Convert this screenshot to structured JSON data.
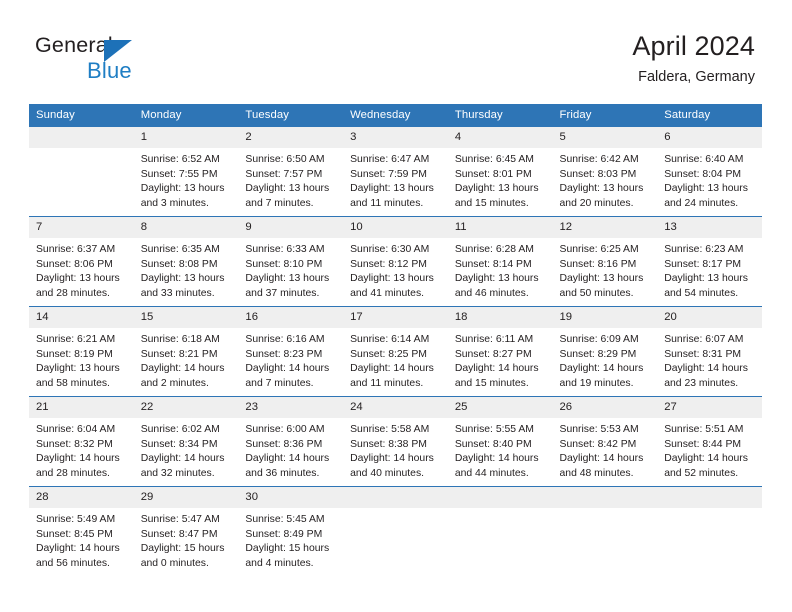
{
  "brand": {
    "name_part1": "General",
    "name_part2": "Blue",
    "accent_color": "#1f7ec4",
    "triangle_color": "#1d71b8"
  },
  "header": {
    "title": "April 2024",
    "subtitle": "Faldera, Germany",
    "header_bg": "#2e75b6",
    "header_text_color": "#ffffff",
    "daynum_bg": "#efefef"
  },
  "weekdays": [
    "Sunday",
    "Monday",
    "Tuesday",
    "Wednesday",
    "Thursday",
    "Friday",
    "Saturday"
  ],
  "labels": {
    "sunrise_prefix": "Sunrise:",
    "sunset_prefix": "Sunset:",
    "daylight_prefix": "Daylight:"
  },
  "weeks": [
    [
      {
        "day": "",
        "empty": true
      },
      {
        "day": "1",
        "sunrise": "Sunrise: 6:52 AM",
        "sunset": "Sunset: 7:55 PM",
        "daylight1": "Daylight: 13 hours",
        "daylight2": "and 3 minutes."
      },
      {
        "day": "2",
        "sunrise": "Sunrise: 6:50 AM",
        "sunset": "Sunset: 7:57 PM",
        "daylight1": "Daylight: 13 hours",
        "daylight2": "and 7 minutes."
      },
      {
        "day": "3",
        "sunrise": "Sunrise: 6:47 AM",
        "sunset": "Sunset: 7:59 PM",
        "daylight1": "Daylight: 13 hours",
        "daylight2": "and 11 minutes."
      },
      {
        "day": "4",
        "sunrise": "Sunrise: 6:45 AM",
        "sunset": "Sunset: 8:01 PM",
        "daylight1": "Daylight: 13 hours",
        "daylight2": "and 15 minutes."
      },
      {
        "day": "5",
        "sunrise": "Sunrise: 6:42 AM",
        "sunset": "Sunset: 8:03 PM",
        "daylight1": "Daylight: 13 hours",
        "daylight2": "and 20 minutes."
      },
      {
        "day": "6",
        "sunrise": "Sunrise: 6:40 AM",
        "sunset": "Sunset: 8:04 PM",
        "daylight1": "Daylight: 13 hours",
        "daylight2": "and 24 minutes."
      }
    ],
    [
      {
        "day": "7",
        "sunrise": "Sunrise: 6:37 AM",
        "sunset": "Sunset: 8:06 PM",
        "daylight1": "Daylight: 13 hours",
        "daylight2": "and 28 minutes."
      },
      {
        "day": "8",
        "sunrise": "Sunrise: 6:35 AM",
        "sunset": "Sunset: 8:08 PM",
        "daylight1": "Daylight: 13 hours",
        "daylight2": "and 33 minutes."
      },
      {
        "day": "9",
        "sunrise": "Sunrise: 6:33 AM",
        "sunset": "Sunset: 8:10 PM",
        "daylight1": "Daylight: 13 hours",
        "daylight2": "and 37 minutes."
      },
      {
        "day": "10",
        "sunrise": "Sunrise: 6:30 AM",
        "sunset": "Sunset: 8:12 PM",
        "daylight1": "Daylight: 13 hours",
        "daylight2": "and 41 minutes."
      },
      {
        "day": "11",
        "sunrise": "Sunrise: 6:28 AM",
        "sunset": "Sunset: 8:14 PM",
        "daylight1": "Daylight: 13 hours",
        "daylight2": "and 46 minutes."
      },
      {
        "day": "12",
        "sunrise": "Sunrise: 6:25 AM",
        "sunset": "Sunset: 8:16 PM",
        "daylight1": "Daylight: 13 hours",
        "daylight2": "and 50 minutes."
      },
      {
        "day": "13",
        "sunrise": "Sunrise: 6:23 AM",
        "sunset": "Sunset: 8:17 PM",
        "daylight1": "Daylight: 13 hours",
        "daylight2": "and 54 minutes."
      }
    ],
    [
      {
        "day": "14",
        "sunrise": "Sunrise: 6:21 AM",
        "sunset": "Sunset: 8:19 PM",
        "daylight1": "Daylight: 13 hours",
        "daylight2": "and 58 minutes."
      },
      {
        "day": "15",
        "sunrise": "Sunrise: 6:18 AM",
        "sunset": "Sunset: 8:21 PM",
        "daylight1": "Daylight: 14 hours",
        "daylight2": "and 2 minutes."
      },
      {
        "day": "16",
        "sunrise": "Sunrise: 6:16 AM",
        "sunset": "Sunset: 8:23 PM",
        "daylight1": "Daylight: 14 hours",
        "daylight2": "and 7 minutes."
      },
      {
        "day": "17",
        "sunrise": "Sunrise: 6:14 AM",
        "sunset": "Sunset: 8:25 PM",
        "daylight1": "Daylight: 14 hours",
        "daylight2": "and 11 minutes."
      },
      {
        "day": "18",
        "sunrise": "Sunrise: 6:11 AM",
        "sunset": "Sunset: 8:27 PM",
        "daylight1": "Daylight: 14 hours",
        "daylight2": "and 15 minutes."
      },
      {
        "day": "19",
        "sunrise": "Sunrise: 6:09 AM",
        "sunset": "Sunset: 8:29 PM",
        "daylight1": "Daylight: 14 hours",
        "daylight2": "and 19 minutes."
      },
      {
        "day": "20",
        "sunrise": "Sunrise: 6:07 AM",
        "sunset": "Sunset: 8:31 PM",
        "daylight1": "Daylight: 14 hours",
        "daylight2": "and 23 minutes."
      }
    ],
    [
      {
        "day": "21",
        "sunrise": "Sunrise: 6:04 AM",
        "sunset": "Sunset: 8:32 PM",
        "daylight1": "Daylight: 14 hours",
        "daylight2": "and 28 minutes."
      },
      {
        "day": "22",
        "sunrise": "Sunrise: 6:02 AM",
        "sunset": "Sunset: 8:34 PM",
        "daylight1": "Daylight: 14 hours",
        "daylight2": "and 32 minutes."
      },
      {
        "day": "23",
        "sunrise": "Sunrise: 6:00 AM",
        "sunset": "Sunset: 8:36 PM",
        "daylight1": "Daylight: 14 hours",
        "daylight2": "and 36 minutes."
      },
      {
        "day": "24",
        "sunrise": "Sunrise: 5:58 AM",
        "sunset": "Sunset: 8:38 PM",
        "daylight1": "Daylight: 14 hours",
        "daylight2": "and 40 minutes."
      },
      {
        "day": "25",
        "sunrise": "Sunrise: 5:55 AM",
        "sunset": "Sunset: 8:40 PM",
        "daylight1": "Daylight: 14 hours",
        "daylight2": "and 44 minutes."
      },
      {
        "day": "26",
        "sunrise": "Sunrise: 5:53 AM",
        "sunset": "Sunset: 8:42 PM",
        "daylight1": "Daylight: 14 hours",
        "daylight2": "and 48 minutes."
      },
      {
        "day": "27",
        "sunrise": "Sunrise: 5:51 AM",
        "sunset": "Sunset: 8:44 PM",
        "daylight1": "Daylight: 14 hours",
        "daylight2": "and 52 minutes."
      }
    ],
    [
      {
        "day": "28",
        "sunrise": "Sunrise: 5:49 AM",
        "sunset": "Sunset: 8:45 PM",
        "daylight1": "Daylight: 14 hours",
        "daylight2": "and 56 minutes."
      },
      {
        "day": "29",
        "sunrise": "Sunrise: 5:47 AM",
        "sunset": "Sunset: 8:47 PM",
        "daylight1": "Daylight: 15 hours",
        "daylight2": "and 0 minutes."
      },
      {
        "day": "30",
        "sunrise": "Sunrise: 5:45 AM",
        "sunset": "Sunset: 8:49 PM",
        "daylight1": "Daylight: 15 hours",
        "daylight2": "and 4 minutes."
      },
      {
        "day": "",
        "empty": true
      },
      {
        "day": "",
        "empty": true
      },
      {
        "day": "",
        "empty": true
      },
      {
        "day": "",
        "empty": true
      }
    ]
  ]
}
